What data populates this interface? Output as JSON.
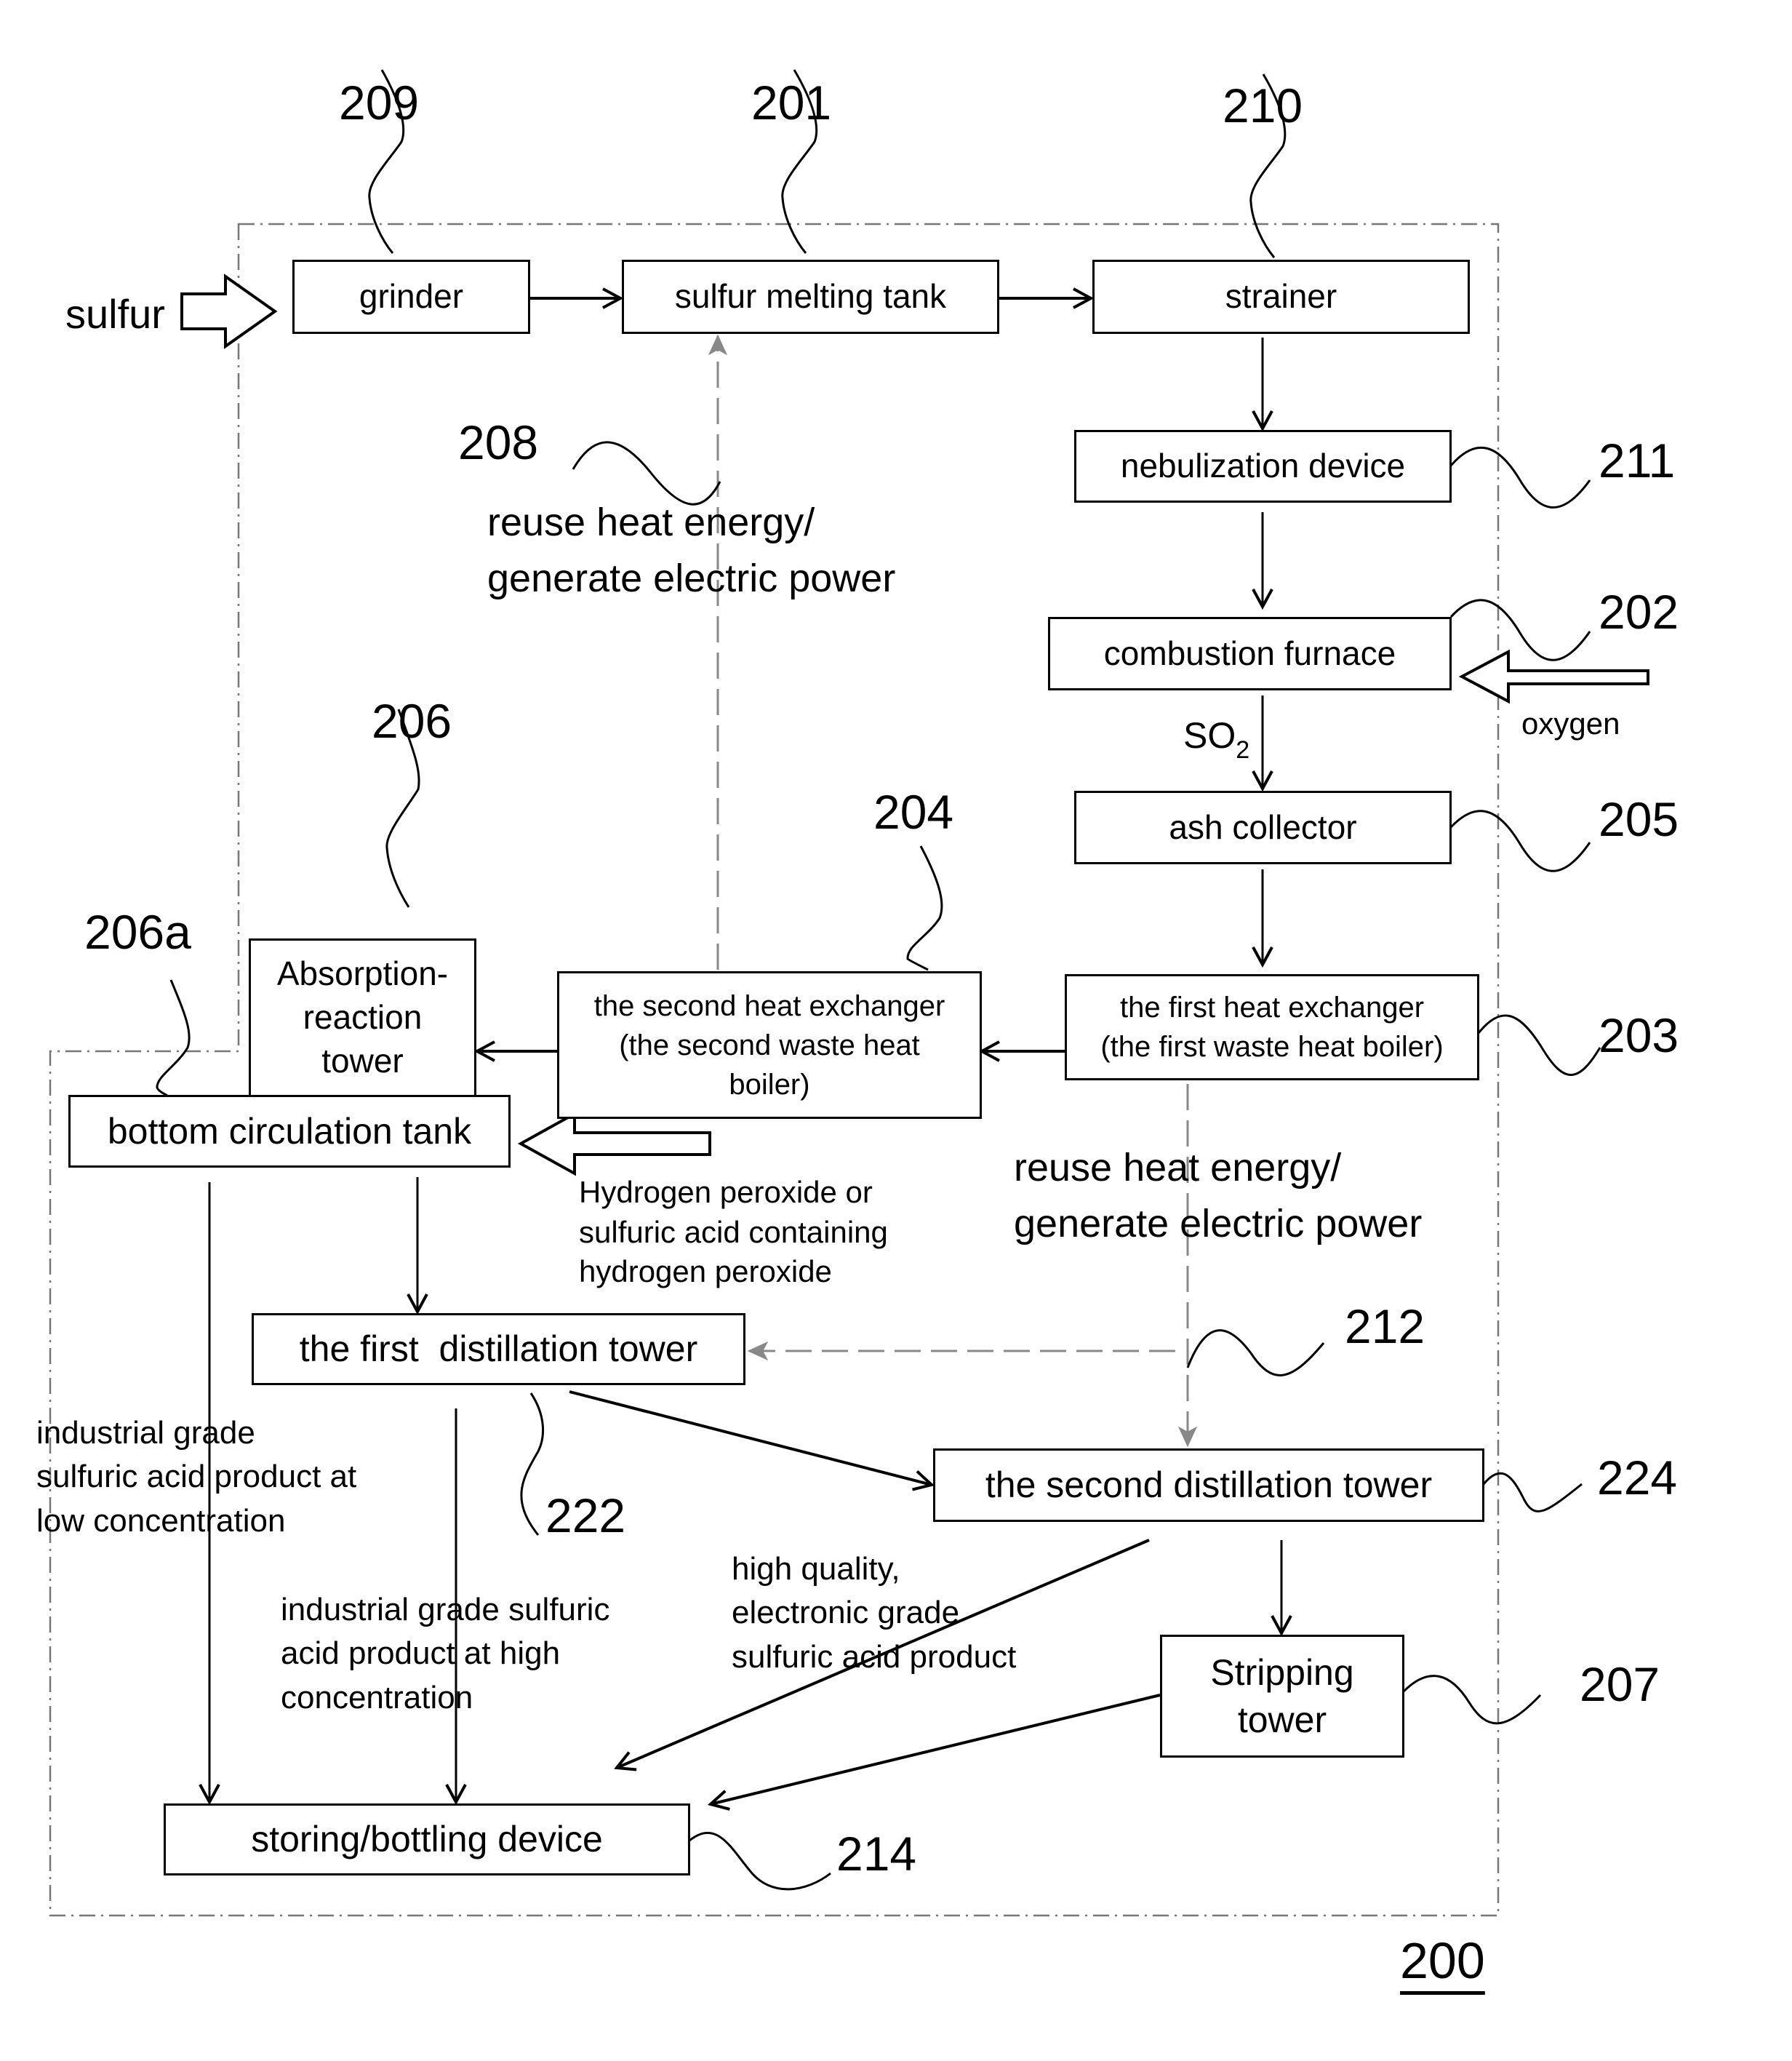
{
  "figure": {
    "number": "200",
    "inputs": {
      "sulfur": "sulfur",
      "oxygen": "oxygen",
      "peroxide_line1": "Hydrogen peroxide or",
      "peroxide_line2": "sulfuric acid containing",
      "peroxide_line3": "hydrogen peroxide"
    },
    "components": {
      "grinder": {
        "ref": "209",
        "label": "grinder"
      },
      "melting_tank": {
        "ref": "201",
        "label": "sulfur melting tank"
      },
      "strainer": {
        "ref": "210",
        "label": "strainer"
      },
      "nebulization": {
        "ref": "211",
        "label": "nebulization device"
      },
      "combustion": {
        "ref": "202",
        "label": "combustion furnace"
      },
      "ash": {
        "ref": "205",
        "label": "ash collector"
      },
      "hx1": {
        "ref": "203",
        "line1": "the first heat exchanger",
        "line2": "(the first waste heat boiler)"
      },
      "hx2": {
        "ref": "204",
        "line1": "the second heat exchanger",
        "line2": "(the second waste heat",
        "line3": "boiler)"
      },
      "absorption": {
        "ref": "206",
        "line1": "Absorption-",
        "line2": "reaction",
        "line3": "tower"
      },
      "bottom_tank": {
        "ref": "206a",
        "label": "bottom circulation tank"
      },
      "dist1": {
        "ref": "222",
        "label": "the first  distillation tower"
      },
      "dist2": {
        "ref": "224",
        "label": "the second distillation tower"
      },
      "stripping": {
        "ref": "207",
        "line1": "Stripping",
        "line2": "tower"
      },
      "storing": {
        "ref": "214",
        "label": "storing/bottling device"
      }
    },
    "heat_reuse_208": {
      "ref": "208",
      "line1": "reuse heat energy/",
      "line2": "generate electric power"
    },
    "heat_reuse_212": {
      "ref": "212",
      "line1": "reuse heat energy/",
      "line2": "generate electric power"
    },
    "so2": {
      "main": "SO",
      "sub": "2"
    },
    "products": {
      "low": {
        "line1": "industrial grade",
        "line2": "sulfuric acid product at",
        "line3": "low concentration"
      },
      "high": {
        "line1": "industrial grade sulfuric",
        "line2": "acid product at high",
        "line3": "concentration"
      },
      "electronic": {
        "line1": "high quality,",
        "line2": "electronic grade",
        "line3": "sulfuric acid product"
      }
    }
  }
}
